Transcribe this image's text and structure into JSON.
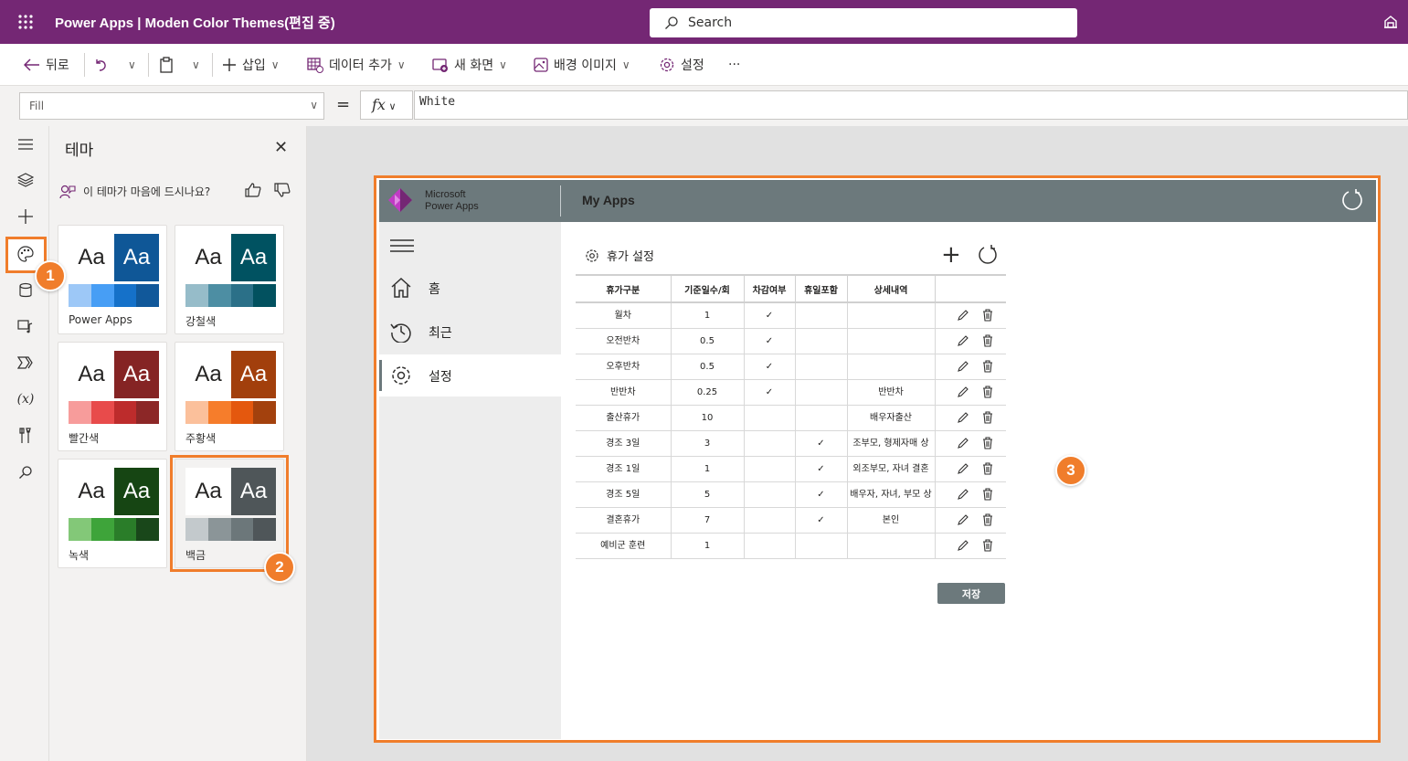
{
  "app": {
    "title": "Power Apps  |  Moden Color Themes(편집 중)",
    "search_placeholder": "Search"
  },
  "commands": {
    "back": "뒤로",
    "insert": "삽입",
    "add_data": "데이터 추가",
    "new_screen": "새 화면",
    "bg_image": "배경 이미지",
    "settings": "설정",
    "more": "···"
  },
  "formula_bar": {
    "property": "Fill",
    "equals": "=",
    "fx": "fx",
    "formula": "White"
  },
  "theme_panel": {
    "title": "테마",
    "feedback": "이 테마가 마음에 드시나요?",
    "themes": [
      {
        "name": "Power Apps",
        "aa": "Aa",
        "dark": "#0f5797",
        "swatches": [
          "#9dc8f7",
          "#479ef5",
          "#1571c9",
          "#11589a"
        ]
      },
      {
        "name": "강철색",
        "aa": "Aa",
        "dark": "#005261",
        "swatches": [
          "#96bcc9",
          "#4d8ea3",
          "#2b7088",
          "#02515f"
        ]
      },
      {
        "name": "빨간색",
        "aa": "Aa",
        "dark": "#852424",
        "swatches": [
          "#f79c9b",
          "#e84b4b",
          "#bd2c2c",
          "#8c2727"
        ]
      },
      {
        "name": "주황색",
        "aa": "Aa",
        "dark": "#a23f0c",
        "swatches": [
          "#fbc09b",
          "#f67d2b",
          "#e4580e",
          "#a3410d"
        ]
      },
      {
        "name": "녹색",
        "aa": "Aa",
        "dark": "#164513",
        "swatches": [
          "#83c878",
          "#3ea43a",
          "#2a7d29",
          "#19471a"
        ]
      },
      {
        "name": "백금",
        "aa": "Aa",
        "dark": "#4f5659",
        "swatches": [
          "#c3c9cc",
          "#8b9598",
          "#6c777a",
          "#4f5659"
        ]
      }
    ]
  },
  "badges": [
    "1",
    "2",
    "3"
  ],
  "preview": {
    "brand_line1": "Microsoft",
    "brand_line2": "Power Apps",
    "header_title": "My Apps",
    "nav": [
      {
        "label": "홈"
      },
      {
        "label": "최근"
      },
      {
        "label": "설정"
      }
    ],
    "section_title": "휴가 설정",
    "table": {
      "headers": [
        "휴가구분",
        "기준일수/회",
        "차감여부",
        "휴일포함",
        "상세내역",
        ""
      ],
      "rows": [
        [
          "월차",
          "1",
          "✓",
          "",
          ""
        ],
        [
          "오전반차",
          "0.5",
          "✓",
          "",
          ""
        ],
        [
          "오후반차",
          "0.5",
          "✓",
          "",
          ""
        ],
        [
          "반반차",
          "0.25",
          "✓",
          "",
          "반반차"
        ],
        [
          "출산휴가",
          "10",
          "",
          "",
          "배우자출산"
        ],
        [
          "경조 3일",
          "3",
          "",
          "✓",
          "조부모, 형제자매 상"
        ],
        [
          "경조 1일",
          "1",
          "",
          "✓",
          "외조부모, 자녀 결혼"
        ],
        [
          "경조 5일",
          "5",
          "",
          "✓",
          "배우자, 자녀, 부모 상"
        ],
        [
          "결혼휴가",
          "7",
          "",
          "✓",
          "본인"
        ],
        [
          "예비군 훈련",
          "1",
          "",
          "",
          ""
        ]
      ]
    },
    "save": "저장"
  },
  "colors": {
    "topbar": "#742774",
    "accent": "#f07d2b",
    "app_header": "#6c797c"
  }
}
